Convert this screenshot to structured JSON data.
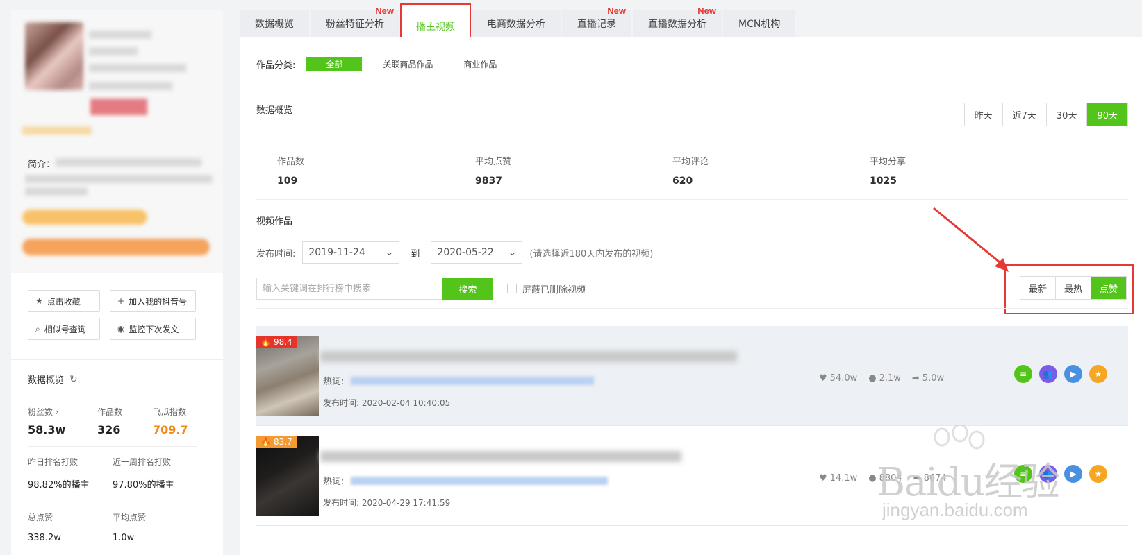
{
  "sidebar": {
    "intro_label": "简介：",
    "actions": {
      "favorite": "点击收藏",
      "add_account": "加入我的抖音号",
      "similar": "相似号查询",
      "monitor": "监控下次发文"
    },
    "stats": {
      "title": "数据概览",
      "fans_label": "粉丝数",
      "fans_value": "58.3w",
      "works_label": "作品数",
      "works_value": "326",
      "index_label": "飞瓜指数",
      "index_value": "709.7",
      "rank_day_label": "昨日排名打败",
      "rank_day_value": "98.82%的播主",
      "rank_week_label": "近一周排名打败",
      "rank_week_value": "97.80%的播主",
      "total_likes_label": "总点赞",
      "total_likes_value": "338.2w",
      "avg_likes_label": "平均点赞",
      "avg_likes_value": "1.0w"
    }
  },
  "tabs": [
    {
      "label": "数据概览",
      "new": ""
    },
    {
      "label": "粉丝特征分析",
      "new": "New"
    },
    {
      "label": "播主视频",
      "new": ""
    },
    {
      "label": "电商数据分析",
      "new": ""
    },
    {
      "label": "直播记录",
      "new": "New"
    },
    {
      "label": "直播数据分析",
      "new": "New"
    },
    {
      "label": "MCN机构",
      "new": ""
    }
  ],
  "main": {
    "category_label": "作品分类:",
    "categories": [
      "全部",
      "关联商品作品",
      "商业作品"
    ],
    "overview_title": "数据概览",
    "ranges": [
      "昨天",
      "近7天",
      "30天",
      "90天"
    ],
    "overview": [
      {
        "label": "作品数",
        "value": "109"
      },
      {
        "label": "平均点赞",
        "value": "9837"
      },
      {
        "label": "平均评论",
        "value": "620"
      },
      {
        "label": "平均分享",
        "value": "1025"
      }
    ],
    "videos_title": "视频作品",
    "publish_label": "发布时间:",
    "date_from": "2019-11-24",
    "to_label": "到",
    "date_to": "2020-05-22",
    "date_hint": "(请选择近180天内发布的视频)",
    "search_placeholder": "输入关键词在排行榜中搜索",
    "search_button": "搜索",
    "hide_deleted": "屏蔽已删除视频",
    "sort": [
      "最新",
      "最热",
      "点赞"
    ]
  },
  "videos": [
    {
      "score": "98.4",
      "badge_color": "#e5352b",
      "keyword_label": "热词:",
      "publish": "发布时间: 2020-02-04 10:40:05",
      "likes": "54.0w",
      "comments": "2.1w",
      "shares": "5.0w"
    },
    {
      "score": "83.7",
      "badge_color": "#f39a32",
      "keyword_label": "热词:",
      "publish": "发布时间: 2020-04-29 17:41:59",
      "likes": "14.1w",
      "comments": "8804",
      "shares": "8674"
    }
  ],
  "watermark": {
    "text": "Baidu经验",
    "sub": "jingyan.baidu.com"
  },
  "colors": {
    "accent": "#52c41a",
    "highlight": "#e53935",
    "orange": "#f08a1a"
  }
}
